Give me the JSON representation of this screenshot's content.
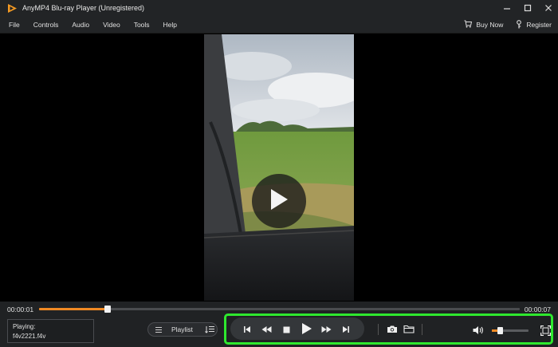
{
  "window": {
    "title": "AnyMP4 Blu-ray Player (Unregistered)"
  },
  "menu": {
    "items": [
      "File",
      "Controls",
      "Audio",
      "Video",
      "Tools",
      "Help"
    ],
    "buy_now": "Buy Now",
    "register": "Register"
  },
  "player": {
    "current_time": "00:00:01",
    "total_time": "00:00:07",
    "progress_fraction": 0.143,
    "volume_fraction": 0.22,
    "playing_label": "Playing:",
    "playing_file": "f4v2221.f4v",
    "playlist_label": "Playlist"
  },
  "colors": {
    "accent": "#f08a24",
    "highlight": "#2ee82e"
  },
  "icons": {
    "app": "anymp4-logo-icon",
    "big_play": "play-icon",
    "prev": "skip-previous-icon",
    "rewind": "rewind-icon",
    "stop": "stop-icon",
    "play": "play-icon",
    "forward": "fast-forward-icon",
    "next": "skip-next-icon",
    "snapshot": "camera-icon",
    "folder": "folder-icon",
    "volume": "volume-icon",
    "fullscreen": "fullscreen-icon"
  }
}
